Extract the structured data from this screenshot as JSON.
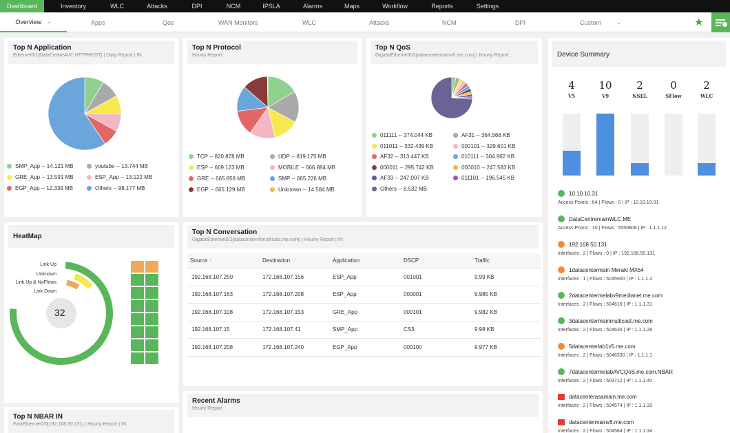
{
  "topnav": [
    "Dashboard",
    "Inventory",
    "WLC",
    "Attacks",
    "DPI",
    "NCM",
    "IPSLA",
    "Alarms",
    "Maps",
    "Workflow",
    "Reports",
    "Settings"
  ],
  "subnav": [
    "Overview",
    "Apps",
    "Qos",
    "WAN Monitors",
    "WLC",
    "Attacks",
    "NCM",
    "DPI",
    "Custom"
  ],
  "colors": {
    "green": "#5ab65a",
    "blue": "#4f8fdf"
  },
  "top_n_app": {
    "title": "Top N Application",
    "subtitle": "Ethernet0/1[DataCentreAVC HTTPHOST] | Daily Report | IN",
    "legend": [
      {
        "label": "SMP_App -- 14.121 MB",
        "color": "#8fd08f"
      },
      {
        "label": "youtube -- 13.744 MB",
        "color": "#a9a9a9"
      },
      {
        "label": "GRE_App -- 13.591 MB",
        "color": "#f5e94f"
      },
      {
        "label": "ESP_App -- 13.122 MB",
        "color": "#f4b6c2"
      },
      {
        "label": "EGP_App -- 12.339 MB",
        "color": "#e26868"
      },
      {
        "label": "Others -- 98.177 MB",
        "color": "#6aa6dc"
      }
    ],
    "chart_data": {
      "type": "pie",
      "categories": [
        "SMP_App",
        "youtube",
        "GRE_App",
        "ESP_App",
        "EGP_App",
        "Others"
      ],
      "values": [
        14.121,
        13.744,
        13.591,
        13.122,
        12.339,
        98.177
      ]
    }
  },
  "top_n_protocol": {
    "title": "Top N Protocol",
    "subtitle": "Hourly Report",
    "legend": [
      {
        "label": "TCP -- 820.878 MB",
        "color": "#8fd08f"
      },
      {
        "label": "UDP -- 819.175 MB",
        "color": "#a9a9a9"
      },
      {
        "label": "ESP -- 669.123 MB",
        "color": "#f5e94f"
      },
      {
        "label": "MOBILE -- 666.884 MB",
        "color": "#f4b6c2"
      },
      {
        "label": "GRE -- 665.858 MB",
        "color": "#e26868"
      },
      {
        "label": "SMP -- 665.226 MB",
        "color": "#6aa6dc"
      },
      {
        "label": "EGP -- 665.129 MB",
        "color": "#8b3a3a"
      },
      {
        "label": "Unknown -- 14.584 MB",
        "color": "#f5b841"
      }
    ],
    "chart_data": {
      "type": "pie",
      "categories": [
        "TCP",
        "UDP",
        "ESP",
        "MOBILE",
        "GRE",
        "SMP",
        "EGP",
        "Unknown"
      ],
      "values": [
        820.878,
        819.175,
        669.123,
        666.884,
        665.858,
        665.226,
        665.129,
        14.584
      ]
    }
  },
  "top_n_qos": {
    "title": "Top N QoS",
    "subtitle": "GigabitEthernet0/2[datacentermainv6.me.com] | Hourly Report ...",
    "legend": [
      {
        "label": "011111 -- 374.044 KB",
        "color": "#8fd08f"
      },
      {
        "label": "AF31 -- 364.568 KB",
        "color": "#a9a9a9"
      },
      {
        "label": "011011 -- 332.439 KB",
        "color": "#f5e94f"
      },
      {
        "label": "000101 -- 329.601 KB",
        "color": "#f4b6c2"
      },
      {
        "label": "AF32 -- 313.447 KB",
        "color": "#e26868"
      },
      {
        "label": "010111 -- 304.962 KB",
        "color": "#6aa6dc"
      },
      {
        "label": "000011 -- 295.742 KB",
        "color": "#8b3a3a"
      },
      {
        "label": "000010 -- 247.583 KB",
        "color": "#f5b841"
      },
      {
        "label": "AF33 -- 247.007 KB",
        "color": "#5b5ba8"
      },
      {
        "label": "011101 -- 196.545 KB",
        "color": "#a64fc9"
      },
      {
        "label": "Others -- 8.532 MB",
        "color": "#6b6396"
      }
    ],
    "chart_data": {
      "type": "pie",
      "categories": [
        "011111",
        "AF31",
        "011011",
        "000101",
        "AF32",
        "010111",
        "000011",
        "000010",
        "AF33",
        "011101",
        "Others"
      ],
      "values": [
        374.044,
        364.568,
        332.439,
        329.601,
        313.447,
        304.962,
        295.742,
        247.583,
        247.007,
        196.545,
        8532
      ]
    }
  },
  "device_summary": {
    "title": "Device Summary",
    "counts": [
      {
        "n": "4",
        "label": "V5",
        "fraction": 0.4
      },
      {
        "n": "10",
        "label": "V9",
        "fraction": 1.0
      },
      {
        "n": "2",
        "label": "NSEL",
        "fraction": 0.2
      },
      {
        "n": "0",
        "label": "SFlow",
        "fraction": 0
      },
      {
        "n": "2",
        "label": "WLC",
        "fraction": 0.2
      }
    ],
    "devices": [
      {
        "name": "10.10.10.31",
        "detail": "Access Points : 64   |   Flows : 0   |   IP : 10.10.10.31",
        "icon": "green"
      },
      {
        "name": "DataCentremainWLC.ME",
        "detail": "Access Points : 10   |   Flows : 5550808   |   IP : 1.1.1.12",
        "icon": "green"
      },
      {
        "name": "192.168.50.131",
        "detail": "Interfaces : 2   |   Flows : 0   |   IP : 192.168.50.131",
        "icon": "orange"
      },
      {
        "name": "1datacentermain Meraki MX64",
        "detail": "Interfaces : 1   |   Flows : 5045900   |   IP : 1.1.1.2",
        "icon": "orange"
      },
      {
        "name": "2datacentermelabv9medianet.me.com",
        "detail": "Interfaces : 2   |   Flows : 504616   |   IP : 1.1.1.31",
        "icon": "green"
      },
      {
        "name": "3datacentermainmulticast.me.com",
        "detail": "Interfaces : 2   |   Flows : 504636   |   IP : 1.1.1.28",
        "icon": "green"
      },
      {
        "name": "5datacenterlab1v5.me.com",
        "detail": "Interfaces : 2   |   Flows : 5046330   |   IP : 1.1.1.1",
        "icon": "orange"
      },
      {
        "name": "7datacentermelabAVCQoS.me.com.NBAR",
        "detail": "Interfaces : 2   |   Flows : 503712   |   IP : 1.1.1.40",
        "icon": "green"
      },
      {
        "name": "datacenterasamain.me.com",
        "detail": "Interfaces : 2   |   Flows : 504574   |   IP : 1.1.1.33",
        "icon": "red"
      },
      {
        "name": "datacentermainv6.me.com",
        "detail": "Interfaces : 2   |   Flows : 504584   |   IP : 1.1.1.34",
        "icon": "red"
      }
    ]
  },
  "heatmap": {
    "title": "HeatMap",
    "center_value": "32",
    "labels": [
      "Link Up",
      "Unknown",
      "Link Up & NoFlows",
      "Link Down"
    ]
  },
  "conversation": {
    "title": "Top N Conversation",
    "subtitle": "GigabitEthernet0/2[datacenterv6multicast.me.com] | Hourly Report | IN",
    "headers": [
      "Source",
      "Destination",
      "Application",
      "DSCP",
      "Traffic"
    ],
    "rows": [
      [
        "192.168.107.250",
        "172.168.107.156",
        "ESP_App",
        "001001",
        "9.99 KB"
      ],
      [
        "192.168.107.163",
        "172.168.107.208",
        "ESP_App",
        "000001",
        "9.985 KB"
      ],
      [
        "192.168.107.108",
        "172.168.107.153",
        "GRE_App",
        "000101",
        "9.982 KB"
      ],
      [
        "192.168.107.15",
        "172.168.107.41",
        "SMP_App",
        "CS3",
        "9.98 KB"
      ],
      [
        "192.168.107.208",
        "172.168.107.240",
        "EGP_App",
        "000100",
        "9.977 KB"
      ]
    ]
  },
  "recent_alarms": {
    "title": "Recent Alarms",
    "subtitle": "Hourly Report"
  },
  "nbar": {
    "title": "Top N NBAR IN",
    "subtitle": "FastEthernet0/0[192.168.50.131] | Hourly Report | IN"
  }
}
